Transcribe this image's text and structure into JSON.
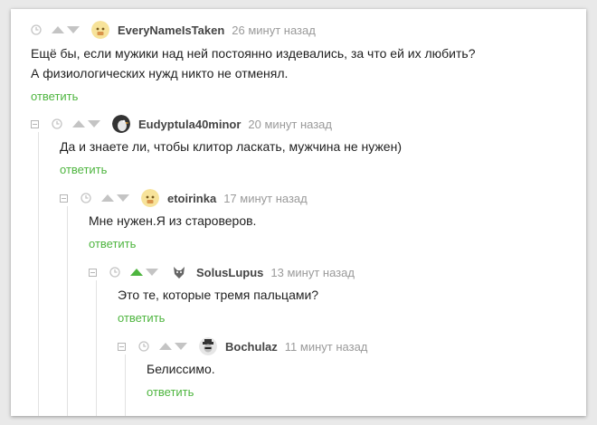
{
  "comments": [
    {
      "user": "EveryNameIsTaken",
      "time": "26 минут назад",
      "text": [
        "Ещё бы, если мужики над ней постоянно издевались, за что ей их любить?",
        "А физиологических нужд никто не отменял."
      ],
      "reply": "ответить",
      "avatar": "smiley-avatar"
    },
    {
      "user": "Eudyptula40minor",
      "time": "20 минут назад",
      "text": [
        "Да и знаете ли, чтобы клитор ласкать, мужчина не нужен)"
      ],
      "reply": "ответить",
      "avatar": "penguin-avatar"
    },
    {
      "user": "etoirinka",
      "time": "17 минут назад",
      "text": [
        "Мне нужен.Я из староверов."
      ],
      "reply": "ответить",
      "avatar": "smiley-avatar"
    },
    {
      "user": "SolusLupus",
      "time": "13 минут назад",
      "text": [
        "Это те, которые тремя пальцами?"
      ],
      "reply": "ответить",
      "avatar": "wolf-avatar",
      "upvoted": true
    },
    {
      "user": "Bochulaz",
      "time": "11 минут назад",
      "text": [
        "Белиссимо."
      ],
      "reply": "ответить",
      "avatar": "hat-man-avatar"
    }
  ],
  "colors": {
    "reply": "#4eb53f",
    "upvote_active": "#4eb53f",
    "arrow_inactive": "#c4c4c4",
    "meta": "#9a9a9a"
  },
  "icons": [
    "collapse-icon",
    "clock-icon",
    "upvote-icon",
    "downvote-icon"
  ]
}
